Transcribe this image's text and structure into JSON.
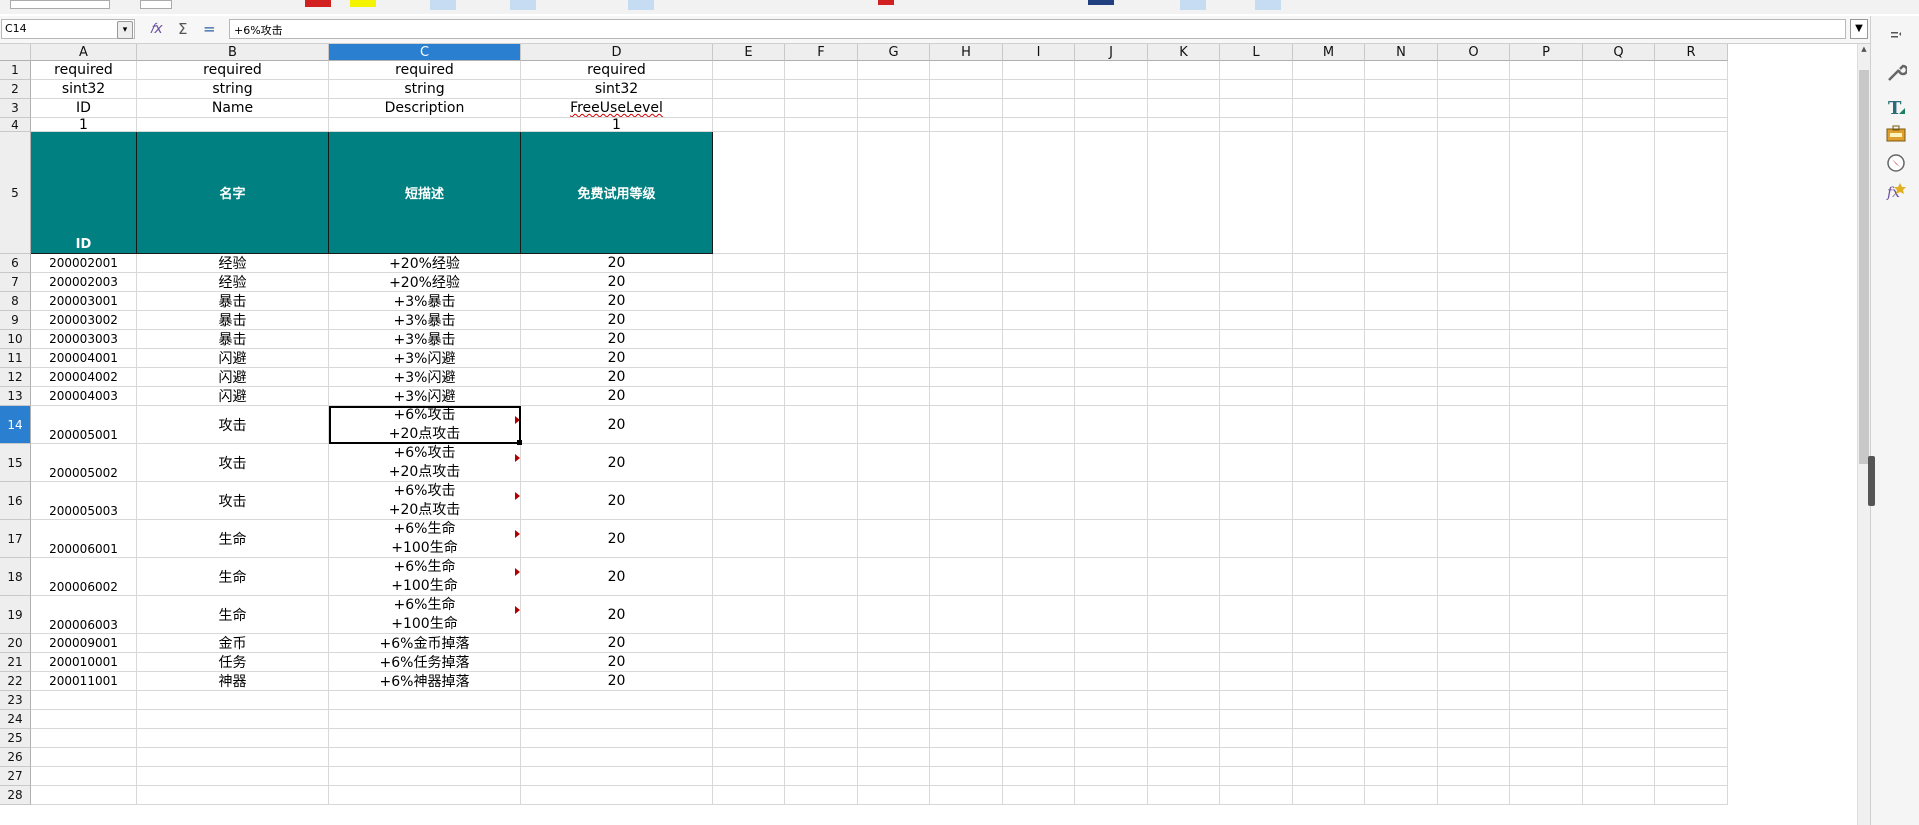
{
  "formula_bar": {
    "cell_ref": "C14",
    "formula_value": "+6%攻击",
    "function_wizard_icon": "function-wizard-icon",
    "sum_icon": "sum-icon",
    "formula_icon": "equals-icon"
  },
  "columns": [
    "A",
    "B",
    "C",
    "D",
    "E",
    "F",
    "G",
    "H",
    "I",
    "J",
    "K",
    "L",
    "M",
    "N",
    "O",
    "P",
    "Q",
    "R"
  ],
  "selected_column": "C",
  "selected_row": "14",
  "rows": [
    {
      "num": "1",
      "cells": [
        "required",
        "required",
        "required",
        "required"
      ]
    },
    {
      "num": "2",
      "cells": [
        "sint32",
        "string",
        "string",
        "sint32"
      ]
    },
    {
      "num": "3",
      "cells": [
        "ID",
        "Name",
        "Description",
        "FreeUseLevel"
      ]
    },
    {
      "num": "4",
      "cells": [
        "1",
        "",
        "",
        "1"
      ]
    },
    {
      "num": "5",
      "cells": [
        "ID",
        "名字",
        "短描述",
        "免费试用等级"
      ]
    },
    {
      "num": "6",
      "cells": [
        "200002001",
        "经验",
        "+20%经验",
        "20"
      ]
    },
    {
      "num": "7",
      "cells": [
        "200002003",
        "经验",
        "+20%经验",
        "20"
      ]
    },
    {
      "num": "8",
      "cells": [
        "200003001",
        "暴击",
        "+3%暴击",
        "20"
      ]
    },
    {
      "num": "9",
      "cells": [
        "200003002",
        "暴击",
        "+3%暴击",
        "20"
      ]
    },
    {
      "num": "10",
      "cells": [
        "200003003",
        "暴击",
        "+3%暴击",
        "20"
      ]
    },
    {
      "num": "11",
      "cells": [
        "200004001",
        "闪避",
        "+3%闪避",
        "20"
      ]
    },
    {
      "num": "12",
      "cells": [
        "200004002",
        "闪避",
        "+3%闪避",
        "20"
      ]
    },
    {
      "num": "13",
      "cells": [
        "200004003",
        "闪避",
        "+3%闪避",
        "20"
      ]
    },
    {
      "num": "14",
      "cells": [
        "200005001",
        "攻击",
        [
          "+6%攻击",
          "+20点攻击"
        ],
        "20"
      ]
    },
    {
      "num": "15",
      "cells": [
        "200005002",
        "攻击",
        [
          "+6%攻击",
          "+20点攻击"
        ],
        "20"
      ]
    },
    {
      "num": "16",
      "cells": [
        "200005003",
        "攻击",
        [
          "+6%攻击",
          "+20点攻击"
        ],
        "20"
      ]
    },
    {
      "num": "17",
      "cells": [
        "200006001",
        "生命",
        [
          "+6%生命",
          "+100生命"
        ],
        "20"
      ]
    },
    {
      "num": "18",
      "cells": [
        "200006002",
        "生命",
        [
          "+6%生命",
          "+100生命"
        ],
        "20"
      ]
    },
    {
      "num": "19",
      "cells": [
        "200006003",
        "生命",
        [
          "+6%生命",
          "+100生命"
        ],
        "20"
      ]
    },
    {
      "num": "20",
      "cells": [
        "200009001",
        "金币",
        "+6%金币掉落",
        "20"
      ]
    },
    {
      "num": "21",
      "cells": [
        "200010001",
        "任务",
        "+6%任务掉落",
        "20"
      ]
    },
    {
      "num": "22",
      "cells": [
        "200011001",
        "神器",
        "+6%神器掉落",
        "20"
      ]
    },
    {
      "num": "23",
      "cells": [
        "",
        "",
        "",
        ""
      ]
    },
    {
      "num": "24",
      "cells": [
        "",
        "",
        "",
        ""
      ]
    },
    {
      "num": "25",
      "cells": [
        "",
        "",
        "",
        ""
      ]
    },
    {
      "num": "26",
      "cells": [
        "",
        "",
        "",
        ""
      ]
    },
    {
      "num": "27",
      "cells": [
        "",
        "",
        "",
        ""
      ]
    },
    {
      "num": "28",
      "cells": [
        "",
        "",
        "",
        ""
      ]
    }
  ],
  "colors": {
    "header_fill": "#008080",
    "selection_blue": "#2a7fd0",
    "comment_marker": "#b00000"
  },
  "sidebar": {
    "items": [
      {
        "name": "properties-icon"
      },
      {
        "name": "styles-icon"
      },
      {
        "name": "gallery-icon"
      },
      {
        "name": "navigator-icon"
      },
      {
        "name": "functions-icon"
      }
    ]
  }
}
